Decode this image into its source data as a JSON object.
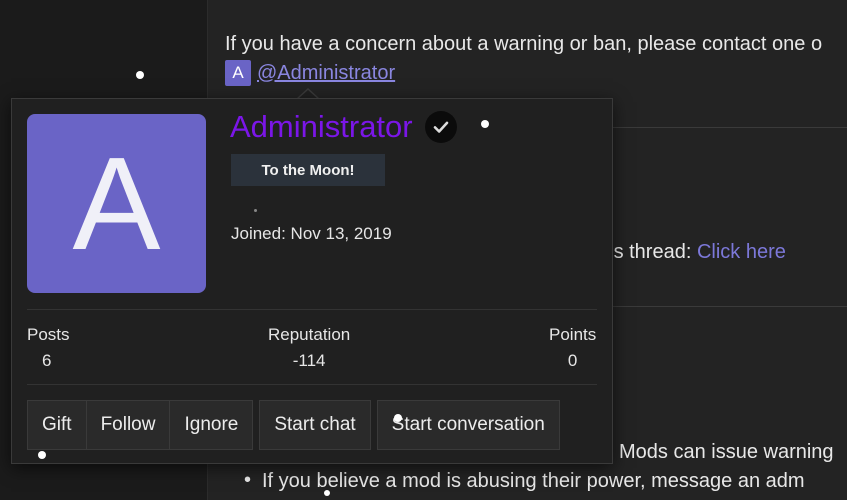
{
  "thread": {
    "line1": "If you have a concern about a warning or ban, please contact one o",
    "mention_avatar_letter": "A",
    "mention_name": "@Administrator",
    "line3_prefix": "his thread: ",
    "line3_link": "Click here",
    "line4": "Mods can issue warning",
    "bullet": "If you believe a mod is abusing their power, message an adm"
  },
  "popup": {
    "avatar_letter": "A",
    "username": "Administrator",
    "user_title": "To the Moon!",
    "joined": "Joined: Nov 13, 2019",
    "stats": [
      {
        "label": "Posts",
        "value": "6"
      },
      {
        "label": "Reputation",
        "value": "-114"
      },
      {
        "label": "Points",
        "value": "0"
      }
    ],
    "buttons": {
      "gift": "Gift",
      "follow": "Follow",
      "ignore": "Ignore",
      "start_chat": "Start chat",
      "start_conversation": "Start conversation"
    }
  },
  "colors": {
    "username": "#7b16e8",
    "avatar_bg": "#6a64c6",
    "link": "#7c78d9"
  }
}
